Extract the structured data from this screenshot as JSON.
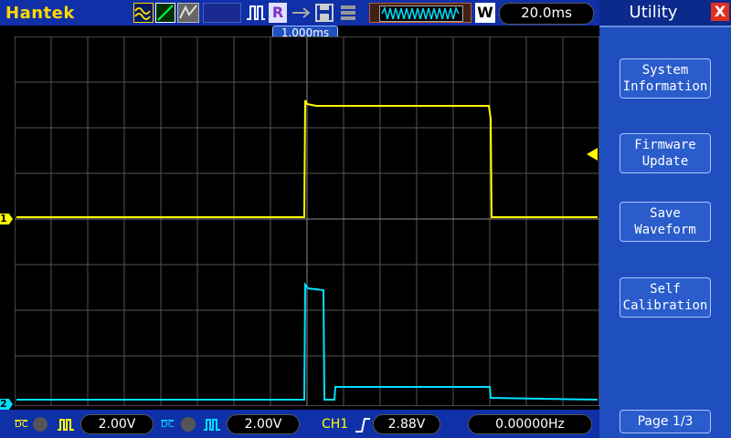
{
  "brand": "Hantek",
  "header": {
    "run_mode_letter": "R",
    "timebase_mode_letter": "W",
    "timebase": "20.0ms",
    "trigger_position": "1.000ms"
  },
  "menu": {
    "title": "Utility",
    "close_symbol": "X",
    "items": [
      {
        "label": "System\nInformation"
      },
      {
        "label": "Firmware\nUpdate"
      },
      {
        "label": "Save\nWaveform"
      },
      {
        "label": "Self\nCalibration"
      }
    ],
    "page": "Page 1/3"
  },
  "channels": [
    {
      "marker": "1",
      "coupling": "DC",
      "scale": "2.00V",
      "color": "#ffff00"
    },
    {
      "marker": "2",
      "coupling": "DC",
      "scale": "2.00V",
      "color": "#00e0ff"
    }
  ],
  "trigger": {
    "source": "CH1",
    "level": "2.88V",
    "frequency": "0.00000Hz"
  },
  "colors": {
    "topbar": "#1030a8",
    "panel": "#1f4fbf",
    "ch1": "#ffff00",
    "ch2": "#00e0ff"
  }
}
